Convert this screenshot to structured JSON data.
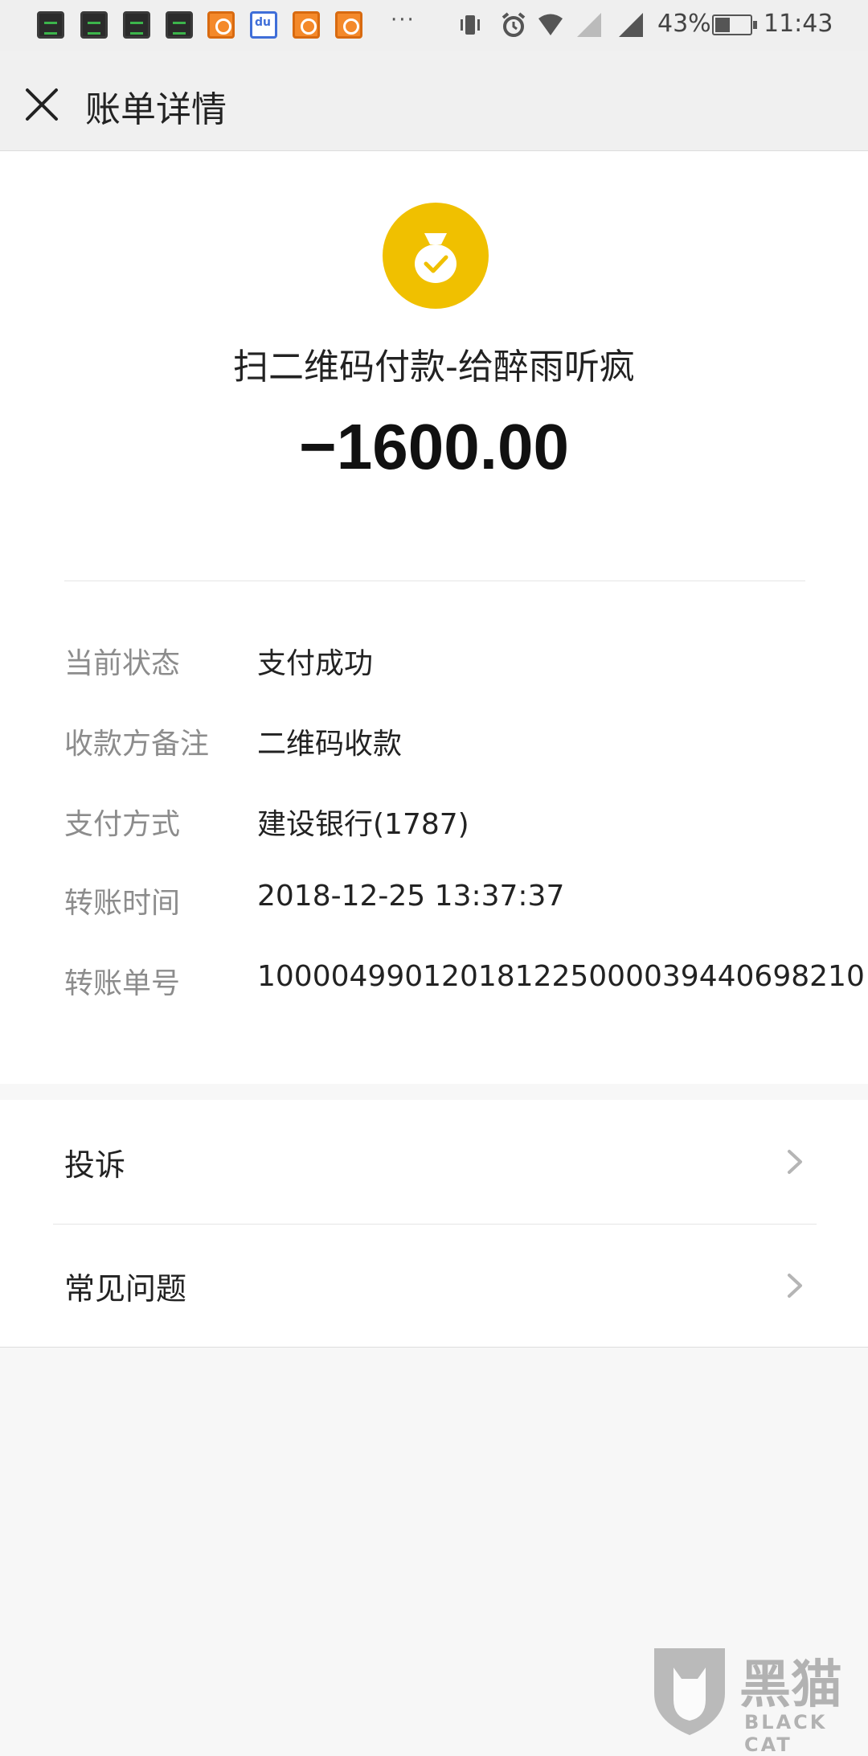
{
  "status_bar": {
    "notification_icons": [
      "monitor-icon",
      "monitor-icon",
      "monitor-icon",
      "monitor-icon",
      "uc-browser-icon",
      "baidu-icon",
      "uc-browser-icon",
      "uc-browser-icon"
    ],
    "more": "···",
    "battery_percent": "43%",
    "battery_level": 0.43,
    "time": "11:43"
  },
  "header": {
    "title": "账单详情",
    "close_icon": "close-icon"
  },
  "bill": {
    "icon": "money-bag-check-icon",
    "icon_color": "#f0c000",
    "title": "扫二维码付款-给醉雨听疯",
    "amount": "−1600.00"
  },
  "details": [
    {
      "label": "当前状态",
      "value": "支付成功"
    },
    {
      "label": "收款方备注",
      "value": "二维码收款"
    },
    {
      "label": "支付方式",
      "value": "建设银行(1787)"
    },
    {
      "label": "转账时间",
      "value": "2018-12-25 13:37:37"
    },
    {
      "label": "转账单号",
      "value": "100004990120181225000039440698210"
    }
  ],
  "actions": [
    {
      "label": "投诉",
      "icon": "chevron-right-icon"
    },
    {
      "label": "常见问题",
      "icon": "chevron-right-icon"
    }
  ],
  "watermark": {
    "cn": "黑猫",
    "en": "BLACK CAT"
  }
}
